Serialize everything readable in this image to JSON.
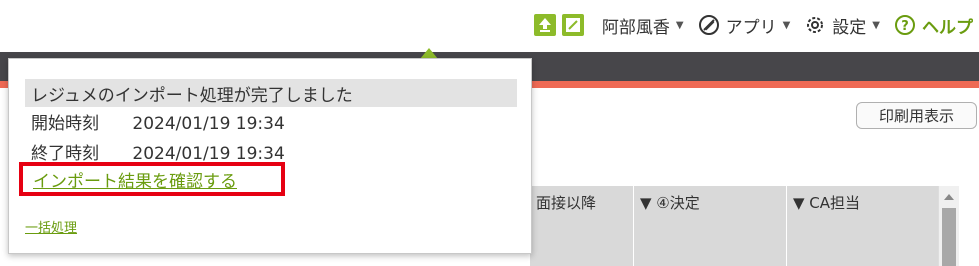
{
  "header": {
    "user_name": "阿部風香",
    "apps_label": "アプリ",
    "settings_label": "設定",
    "help_label": "ヘルプ"
  },
  "toolbar": {
    "print_label": "印刷用表示"
  },
  "table": {
    "headers": [
      "面接以降",
      "▼ ④決定",
      "▼ CA担当"
    ]
  },
  "popup": {
    "message": "レジュメのインポート処理が完了しました",
    "start_label": "開始時刻",
    "start_time": "2024/01/19 19:34",
    "end_label": "終了時刻",
    "end_time": "2024/01/19 19:34",
    "confirm_link": "インポート結果を確認する",
    "batch_link": "一括処理"
  },
  "colors": {
    "accent_green": "#8dbb2a",
    "link_green": "#6a9c0f",
    "dark_bar": "#47464a",
    "red_bar": "#ee6a55",
    "highlight_red": "#e60012"
  }
}
